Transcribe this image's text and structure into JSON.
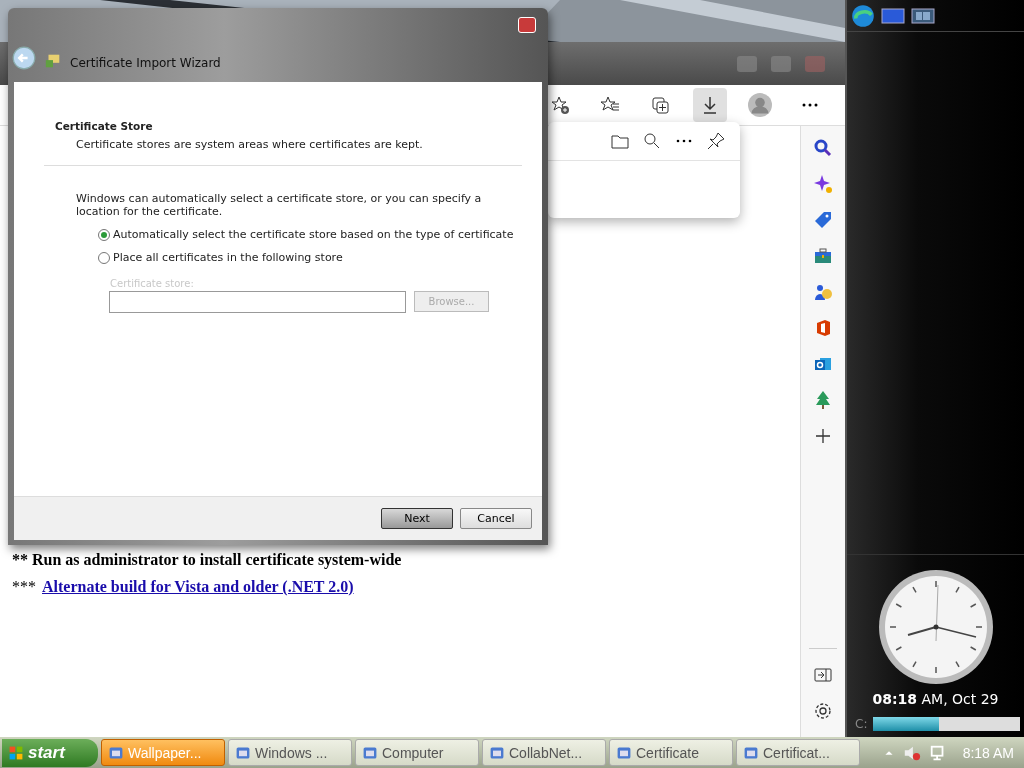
{
  "wizard": {
    "title": "Certificate Import Wizard",
    "heading": "Certificate Store",
    "subheading": "Certificate stores are system areas where certificates are kept.",
    "intro": "Windows can automatically select a certificate store, or you can specify a location for the certificate.",
    "options": [
      {
        "label": "Automatically select the certificate store based on the type of certificate",
        "selected": true
      },
      {
        "label": "Place all certificates in the following store",
        "selected": false
      }
    ],
    "store": {
      "label": "Certificate store:",
      "disabled": true,
      "button": "Browse..."
    },
    "buttons": [
      {
        "label": "Next",
        "default": true
      },
      {
        "label": "Cancel",
        "default": false
      }
    ]
  },
  "browser": {
    "page": {
      "note": "** Run as administrator to install certificate system-wide",
      "link_prefix": "***",
      "link": "Alternate build for Vista and older (.NET 2.0)"
    }
  },
  "gadgets": {
    "clock_caption": "**08:18** AM, Oct 29",
    "drive": {
      "label": "C:",
      "level": 0.45
    }
  },
  "taskbar": {
    "start": "start",
    "items": [
      {
        "label": "Wallpaper...",
        "selected": true
      },
      {
        "label": "Windows ...",
        "selected": false
      },
      {
        "label": "Computer",
        "selected": false
      },
      {
        "label": "CollabNet...",
        "selected": false
      },
      {
        "label": "Certificate",
        "selected": false
      },
      {
        "label": "Certificat...",
        "selected": false
      }
    ],
    "clock": "8:18 AM"
  }
}
